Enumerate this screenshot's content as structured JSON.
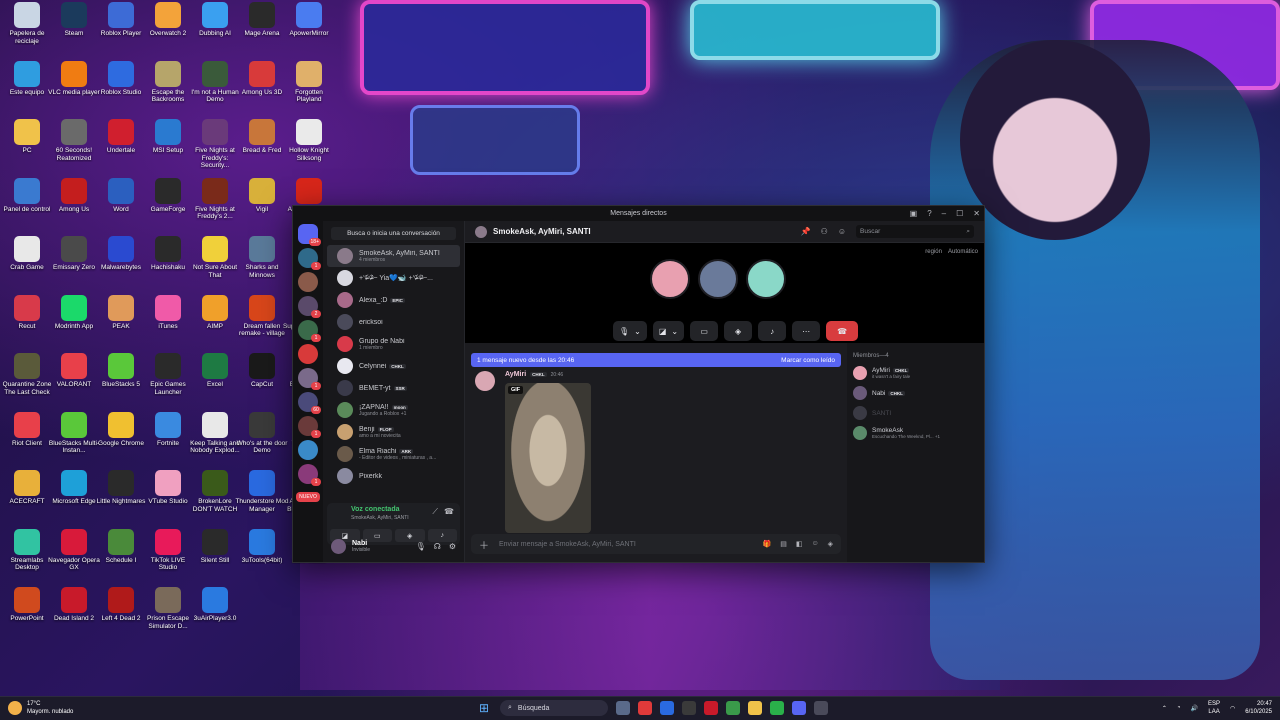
{
  "desktop_icons": [
    {
      "label": "Papelera de reciclaje",
      "color": "#c9d6e4"
    },
    {
      "label": "Steam",
      "color": "#1b3a5c"
    },
    {
      "label": "Roblox Player",
      "color": "#3d6bd6"
    },
    {
      "label": "Overwatch 2",
      "color": "#f3a33a"
    },
    {
      "label": "Dubbing AI",
      "color": "#3aa0f0"
    },
    {
      "label": "Mage Arena",
      "color": "#2a2a2a"
    },
    {
      "label": "ApowerMirror",
      "color": "#4a7cf0"
    },
    {
      "label": "Este equipo",
      "color": "#2f9de0"
    },
    {
      "label": "VLC media player",
      "color": "#f07c12"
    },
    {
      "label": "Roblox Studio",
      "color": "#2e6be0"
    },
    {
      "label": "Escape the Backrooms",
      "color": "#b6a56a"
    },
    {
      "label": "I'm not a Human Demo",
      "color": "#3a5a3a"
    },
    {
      "label": "Among Us 3D",
      "color": "#d83a3a"
    },
    {
      "label": "Forgotten Playland",
      "color": "#e0b06a"
    },
    {
      "label": "PC",
      "color": "#f0c24a"
    },
    {
      "label": "60 Seconds! Reatomized",
      "color": "#6a6a6a"
    },
    {
      "label": "Undertale",
      "color": "#d01f2e"
    },
    {
      "label": "MSI Setup",
      "color": "#2a7ad0"
    },
    {
      "label": "Five Nights at Freddy's: Security...",
      "color": "#6a3a7a"
    },
    {
      "label": "Bread & Fred",
      "color": "#c8763a"
    },
    {
      "label": "Hollow Knight Silksong",
      "color": "#eaeaea"
    },
    {
      "label": "Panel de control",
      "color": "#3a7ad0"
    },
    {
      "label": "Among Us",
      "color": "#c41e1e"
    },
    {
      "label": "Word",
      "color": "#2b5fbf"
    },
    {
      "label": "GameForge",
      "color": "#2a2a2a"
    },
    {
      "label": "Five Nights at Freddy's 2...",
      "color": "#7a2a1a"
    },
    {
      "label": "Vigil",
      "color": "#d8b03a"
    },
    {
      "label": "Adobe Acrobat",
      "color": "#d8261a"
    },
    {
      "label": "Crab Game",
      "color": "#e8e8e8"
    },
    {
      "label": "Emissary Zero",
      "color": "#4a4a4a"
    },
    {
      "label": "Malwarebytes",
      "color": "#2a4ad0"
    },
    {
      "label": "Hachishaku",
      "color": "#2a2a2a"
    },
    {
      "label": "Not Sure About That",
      "color": "#f0d03a"
    },
    {
      "label": "Sharks and Minnows",
      "color": "#5a7a9a"
    },
    {
      "label": "Discord",
      "color": "#5865f2"
    },
    {
      "label": "Recut",
      "color": "#d83a4a"
    },
    {
      "label": "Modrinth App",
      "color": "#1bd96a"
    },
    {
      "label": "PEAK",
      "color": "#e09a5a"
    },
    {
      "label": "iTunes",
      "color": "#f05aa8"
    },
    {
      "label": "AIMP",
      "color": "#f0a02a"
    },
    {
      "label": "Dream fallen remake - village",
      "color": "#d8461a"
    },
    {
      "label": "Super Bunny Man",
      "color": "#3a9ad0"
    },
    {
      "label": "Quarantine Zone The Last Check",
      "color": "#5a5a3a"
    },
    {
      "label": "VALORANT",
      "color": "#e8404a"
    },
    {
      "label": "BlueStacks 5",
      "color": "#5ac83a"
    },
    {
      "label": "Epic Games Launcher",
      "color": "#2a2a2a"
    },
    {
      "label": "Excel",
      "color": "#1e7a43"
    },
    {
      "label": "CapCut",
      "color": "#1a1a1a"
    },
    {
      "label": "Burgie's cozy kitchen",
      "color": "#e8a86a"
    },
    {
      "label": "Riot Client",
      "color": "#e8404a"
    },
    {
      "label": "BlueStacks Multi-Instan...",
      "color": "#5ac83a"
    },
    {
      "label": "Google Chrome",
      "color": "#f0c030"
    },
    {
      "label": "Fortnite",
      "color": "#3a8ae0"
    },
    {
      "label": "Keep Talking and Nobody Explod...",
      "color": "#e8e8e8"
    },
    {
      "label": "Who's at the door Demo",
      "color": "#3a3a3a"
    },
    {
      "label": "VALORANT",
      "color": "#1a1a1a"
    },
    {
      "label": "ACECRAFT",
      "color": "#e8b03a"
    },
    {
      "label": "Microsoft Edge",
      "color": "#1ea0d8"
    },
    {
      "label": "Little Nightmares",
      "color": "#2a2a2a"
    },
    {
      "label": "VTube Studio",
      "color": "#f0a0c0"
    },
    {
      "label": "BrokenLore DON'T WATCH",
      "color": "#3a5a1a"
    },
    {
      "label": "Thunderstore Mod Manager",
      "color": "#2a6ae0"
    },
    {
      "label": "ACECRAFT - BlueStacks A...",
      "color": "#e8b03a"
    },
    {
      "label": "Streamlabs Desktop",
      "color": "#31c3a2"
    },
    {
      "label": "Navegador Opera GX",
      "color": "#d81a3a"
    },
    {
      "label": "Schedule I",
      "color": "#4a8a3a"
    },
    {
      "label": "TikTok LIVE Studio",
      "color": "#e81a5a"
    },
    {
      "label": "Silent Still",
      "color": "#2a2a2a"
    },
    {
      "label": "3uTools(64bit)",
      "color": "#2a7ae0"
    },
    {
      "label": "OBS Studio",
      "color": "#3a3a3a"
    },
    {
      "label": "PowerPoint",
      "color": "#d04a1e"
    },
    {
      "label": "Dead Island 2",
      "color": "#c81a2a"
    },
    {
      "label": "Left 4 Dead 2",
      "color": "#b01a1a"
    },
    {
      "label": "Prison Escape Simulator D...",
      "color": "#7a6a5a"
    },
    {
      "label": "3uAirPlayer3.0",
      "color": "#2a7ae0"
    }
  ],
  "window": {
    "title": "Mensajes directos",
    "minimize": "–",
    "maximize": "☐",
    "close": "✕"
  },
  "guilds": {
    "top_badge": "18+",
    "badges": [
      "1",
      "30",
      "2",
      "1",
      "2",
      "1",
      "60",
      "1",
      "1"
    ],
    "nuevo": "NUEVO"
  },
  "dm_panel": {
    "search": "Busca o inicia una conversación",
    "items": [
      {
        "name": "SmokeAsk, AyMiri, SANTI",
        "sub": "4 miembros",
        "active": true,
        "tag": ""
      },
      {
        "name": "+‘ᵒ̴̶̷᷄ ᵒ̴̶̷᷅’~ Yia💙🐋 +‘ᵒ̴̶̷᷄ ᵒ̴̶̷᷅’~...",
        "sub": "",
        "active": false,
        "tag": ""
      },
      {
        "name": "Alexa_:D",
        "sub": "",
        "active": false,
        "tag": "EPIC"
      },
      {
        "name": "ericksoi",
        "sub": "",
        "active": false,
        "tag": ""
      },
      {
        "name": "Grupo de Nabi",
        "sub": "1 miembro",
        "active": false,
        "tag": ""
      },
      {
        "name": "Celynnei",
        "sub": "",
        "active": false,
        "tag": "CHKL"
      },
      {
        "name": "BEMET-yt",
        "sub": "",
        "active": false,
        "tag": "SSR"
      },
      {
        "name": "¡ZAPNA!!",
        "sub": "Jugando a Roblox +1",
        "active": false,
        "tag": "moon"
      },
      {
        "name": "Benji",
        "sub": "amo a mi noviecita",
        "active": false,
        "tag": "FLOP"
      },
      {
        "name": "Elma Riachi",
        "sub": "- Editor de videos , miniaturas , a...",
        "active": false,
        "tag": "ARK"
      },
      {
        "name": "Pixerkk",
        "sub": "",
        "active": false,
        "tag": ""
      }
    ],
    "voice": {
      "status": "Voz conectada",
      "sub": "SmokeAsk, AyMiri, SANTI"
    },
    "user": {
      "name": "Nabi",
      "status": "Invisible"
    }
  },
  "header": {
    "title": "SmokeAsk, AyMiri, SANTI",
    "search_placeholder": "Buscar",
    "region_label": "región",
    "region_value": "Automático"
  },
  "call": {
    "avatar_colors": [
      "#e8a0b0",
      "#6a7a9a",
      "#8ad8c8"
    ]
  },
  "chat": {
    "new_messages": "1 mensaje nuevo desde las 20:46",
    "mark_read": "Marcar como leído",
    "message": {
      "author": "AyMiri",
      "tag": "CHKL",
      "time": "20:46",
      "gif_label": "GIF"
    },
    "composer_placeholder": "Enviar mensaje a SmokeAsk, AyMiri, SANTI"
  },
  "members": {
    "header": "Miembros—4",
    "list": [
      {
        "name": "AyMiri",
        "tag": "CHKL",
        "sub": "it wasn't a fairy tale",
        "offline": false
      },
      {
        "name": "Nabi",
        "tag": "CHKL",
        "sub": "",
        "offline": false
      },
      {
        "name": "SANTI",
        "tag": "",
        "sub": "",
        "offline": true
      },
      {
        "name": "SmokeAsk",
        "tag": "",
        "sub": "Escuchando The Weeknd, Pl... +1",
        "offline": false
      }
    ]
  },
  "taskbar": {
    "weather_temp": "17°C",
    "weather_desc": "Mayorm. nublado",
    "search": "Búsqueda",
    "lang_top": "ESP",
    "lang_bottom": "LAA",
    "time": "20:47",
    "date": "6/10/2025"
  }
}
